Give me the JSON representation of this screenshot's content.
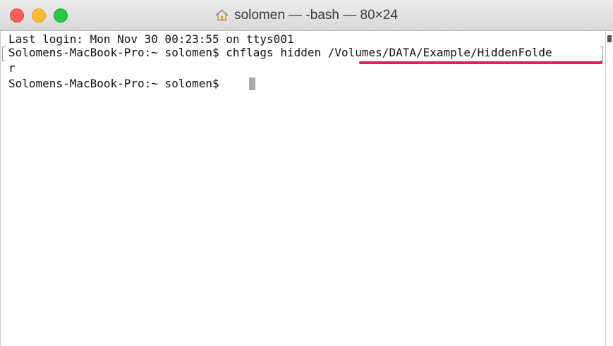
{
  "window": {
    "title": "solomen — -bash — 80×24"
  },
  "terminal": {
    "lines": [
      "Last login: Mon Nov 30 00:23:55 on ttys001",
      "Solomens-MacBook-Pro:~ solomen$ chflags hidden /Volumes/DATA/Example/HiddenFolde",
      "r",
      "Solomens-MacBook-Pro:~ solomen$ "
    ]
  },
  "colors": {
    "highlight_underline": "#e01f5d",
    "close": "#fc5f57",
    "minimize": "#fdbc2e",
    "zoom": "#28c840"
  },
  "icons": {
    "title_icon": "home-icon"
  }
}
